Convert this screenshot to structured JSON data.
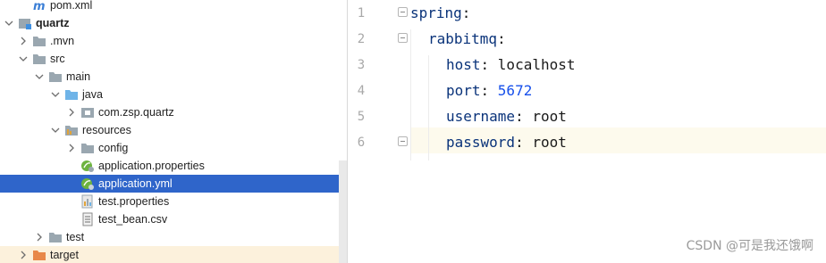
{
  "tree": {
    "items": [
      {
        "label": "pom.xml",
        "icon": "maven-icon",
        "expanded": null
      },
      {
        "label": "quartz",
        "icon": "module-folder-icon",
        "expanded": true
      },
      {
        "label": ".mvn",
        "icon": "folder-icon",
        "expanded": false
      },
      {
        "label": "src",
        "icon": "folder-icon",
        "expanded": true
      },
      {
        "label": "main",
        "icon": "folder-icon",
        "expanded": true
      },
      {
        "label": "java",
        "icon": "source-folder-icon",
        "expanded": true
      },
      {
        "label": "com.zsp.quartz",
        "icon": "package-icon",
        "expanded": false
      },
      {
        "label": "resources",
        "icon": "resources-folder-icon",
        "expanded": true
      },
      {
        "label": "config",
        "icon": "folder-icon",
        "expanded": false
      },
      {
        "label": "application.properties",
        "icon": "spring-properties-icon",
        "expanded": null
      },
      {
        "label": "application.yml",
        "icon": "spring-yml-icon",
        "expanded": null,
        "selected": true
      },
      {
        "label": "test.properties",
        "icon": "properties-file-icon",
        "expanded": null
      },
      {
        "label": "test_bean.csv",
        "icon": "text-file-icon",
        "expanded": null
      },
      {
        "label": "test",
        "icon": "folder-icon",
        "expanded": false
      },
      {
        "label": "target",
        "icon": "excluded-folder-icon",
        "expanded": false
      }
    ]
  },
  "editor": {
    "lines": [
      {
        "number": "1",
        "key": "spring",
        "sep": ":",
        "value": ""
      },
      {
        "number": "2",
        "key": "rabbitmq",
        "sep": ":",
        "value": ""
      },
      {
        "number": "3",
        "key": "host",
        "sep": ": ",
        "value": "localhost"
      },
      {
        "number": "4",
        "key": "port",
        "sep": ": ",
        "value": "5672",
        "numeric": true
      },
      {
        "number": "5",
        "key": "username",
        "sep": ": ",
        "value": "root"
      },
      {
        "number": "6",
        "key": "password",
        "sep": ": ",
        "value": "root"
      }
    ]
  },
  "watermark": "CSDN @可是我还饿啊",
  "colors": {
    "selection": "#2f65ca",
    "yaml_key": "#0a337a",
    "yaml_number": "#1750eb",
    "current_line": "#fdfaed"
  }
}
